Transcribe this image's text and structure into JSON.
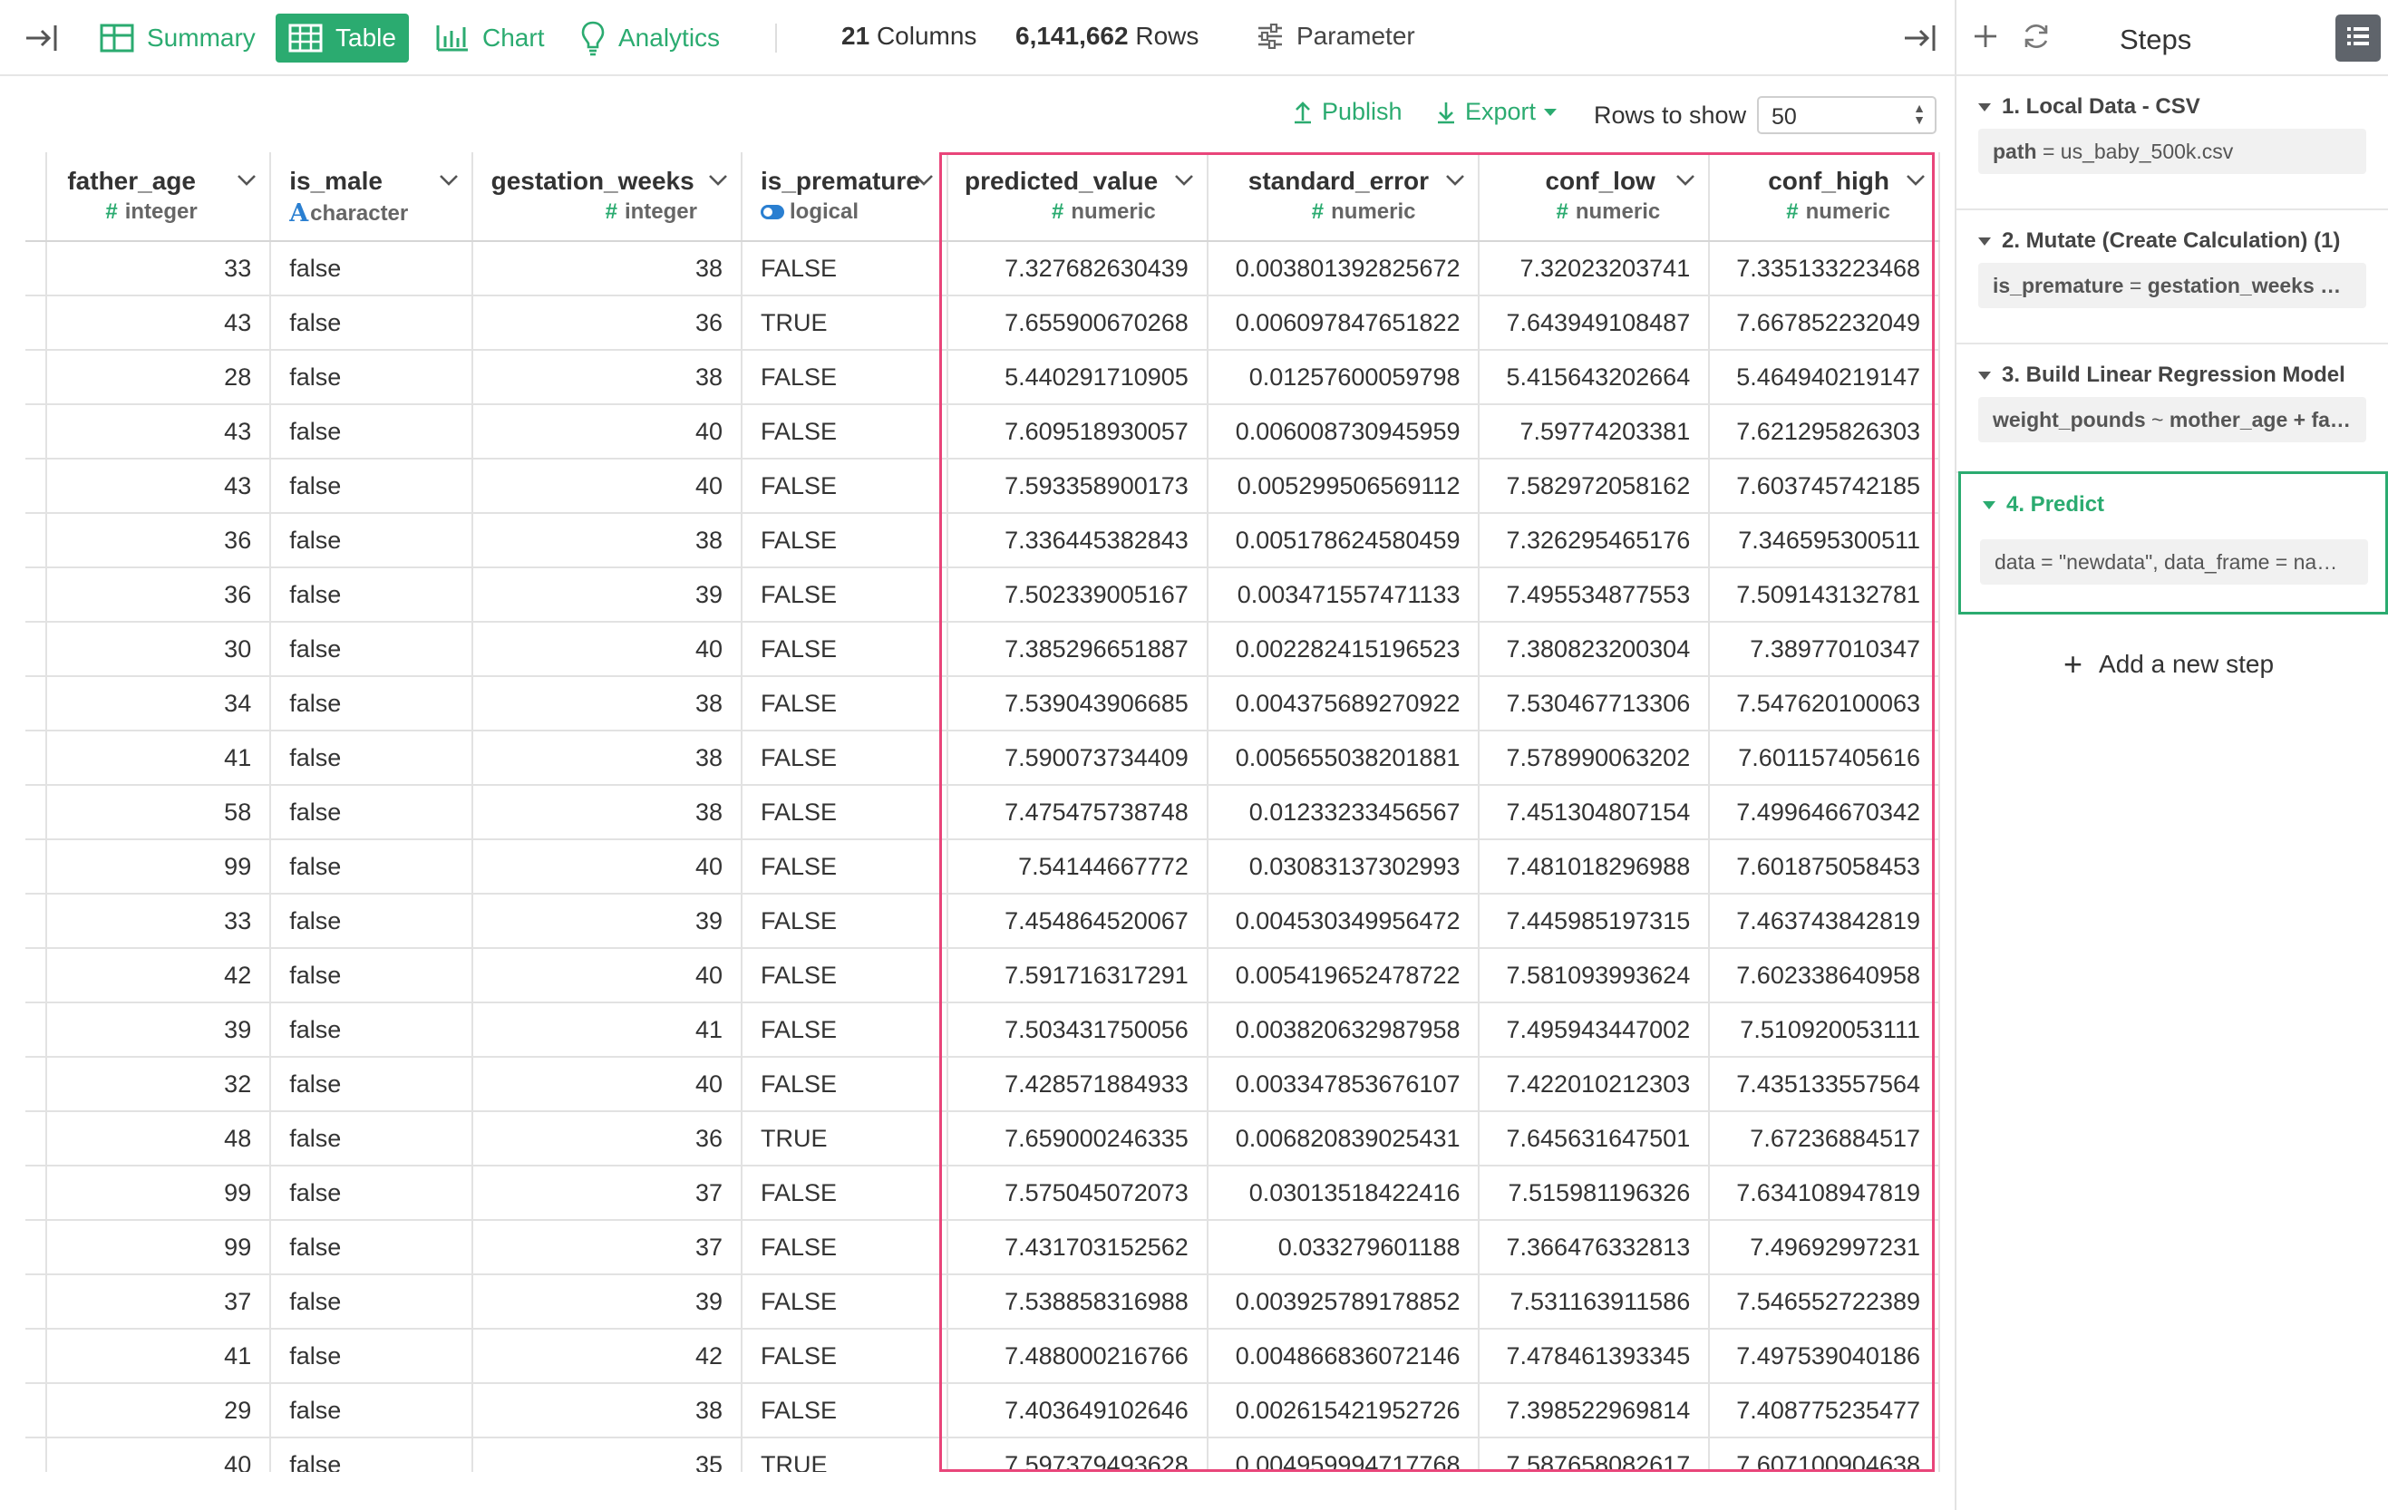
{
  "header": {
    "tabs": [
      {
        "label": "Summary",
        "icon": "summary-grid-icon"
      },
      {
        "label": "Table",
        "icon": "table-icon",
        "active": true
      },
      {
        "label": "Chart",
        "icon": "bar-chart-icon"
      },
      {
        "label": "Analytics",
        "icon": "lightbulb-icon"
      }
    ],
    "columns_count": "21",
    "columns_label": "Columns",
    "rows_count": "6,141,662",
    "rows_label": "Rows",
    "parameter_label": "Parameter"
  },
  "toolbar": {
    "publish_label": "Publish",
    "export_label": "Export",
    "rows_to_show_label": "Rows to show",
    "rows_to_show_value": "50"
  },
  "table": {
    "columns": [
      {
        "name": "father_age",
        "type": "integer",
        "type_icon": "hash"
      },
      {
        "name": "is_male",
        "type": "character",
        "type_icon": "A"
      },
      {
        "name": "gestation_weeks",
        "type": "integer",
        "type_icon": "hash"
      },
      {
        "name": "is_premature",
        "type": "logical",
        "type_icon": "toggle"
      },
      {
        "name": "predicted_value",
        "type": "numeric",
        "type_icon": "hash"
      },
      {
        "name": "standard_error",
        "type": "numeric",
        "type_icon": "hash"
      },
      {
        "name": "conf_low",
        "type": "numeric",
        "type_icon": "hash"
      },
      {
        "name": "conf_high",
        "type": "numeric",
        "type_icon": "hash"
      }
    ],
    "rows": [
      [
        "33",
        "false",
        "38",
        "FALSE",
        "7.327682630439",
        "0.003801392825672",
        "7.32023203741",
        "7.335133223468"
      ],
      [
        "43",
        "false",
        "36",
        "TRUE",
        "7.655900670268",
        "0.006097847651822",
        "7.643949108487",
        "7.667852232049"
      ],
      [
        "28",
        "false",
        "38",
        "FALSE",
        "5.440291710905",
        "0.01257600059798",
        "5.415643202664",
        "5.464940219147"
      ],
      [
        "43",
        "false",
        "40",
        "FALSE",
        "7.609518930057",
        "0.006008730945959",
        "7.59774203381",
        "7.621295826303"
      ],
      [
        "43",
        "false",
        "40",
        "FALSE",
        "7.593358900173",
        "0.005299506569112",
        "7.582972058162",
        "7.603745742185"
      ],
      [
        "36",
        "false",
        "38",
        "FALSE",
        "7.336445382843",
        "0.005178624580459",
        "7.326295465176",
        "7.346595300511"
      ],
      [
        "36",
        "false",
        "39",
        "FALSE",
        "7.502339005167",
        "0.003471557471133",
        "7.495534877553",
        "7.509143132781"
      ],
      [
        "30",
        "false",
        "40",
        "FALSE",
        "7.385296651887",
        "0.002282415196523",
        "7.380823200304",
        "7.38977010347"
      ],
      [
        "34",
        "false",
        "38",
        "FALSE",
        "7.539043906685",
        "0.004375689270922",
        "7.530467713306",
        "7.547620100063"
      ],
      [
        "41",
        "false",
        "38",
        "FALSE",
        "7.590073734409",
        "0.005655038201881",
        "7.578990063202",
        "7.601157405616"
      ],
      [
        "58",
        "false",
        "38",
        "FALSE",
        "7.475475738748",
        "0.01233233456567",
        "7.451304807154",
        "7.499646670342"
      ],
      [
        "99",
        "false",
        "40",
        "FALSE",
        "7.54144667772",
        "0.03083137302993",
        "7.481018296988",
        "7.601875058453"
      ],
      [
        "33",
        "false",
        "39",
        "FALSE",
        "7.454864520067",
        "0.004530349956472",
        "7.445985197315",
        "7.463743842819"
      ],
      [
        "42",
        "false",
        "40",
        "FALSE",
        "7.591716317291",
        "0.005419652478722",
        "7.581093993624",
        "7.602338640958"
      ],
      [
        "39",
        "false",
        "41",
        "FALSE",
        "7.503431750056",
        "0.003820632987958",
        "7.495943447002",
        "7.510920053111"
      ],
      [
        "32",
        "false",
        "40",
        "FALSE",
        "7.428571884933",
        "0.003347853676107",
        "7.422010212303",
        "7.435133557564"
      ],
      [
        "48",
        "false",
        "36",
        "TRUE",
        "7.659000246335",
        "0.006820839025431",
        "7.645631647501",
        "7.67236884517"
      ],
      [
        "99",
        "false",
        "37",
        "FALSE",
        "7.575045072073",
        "0.03013518422416",
        "7.515981196326",
        "7.634108947819"
      ],
      [
        "99",
        "false",
        "37",
        "FALSE",
        "7.431703152562",
        "0.033279601188",
        "7.366476332813",
        "7.49692997231"
      ],
      [
        "37",
        "false",
        "39",
        "FALSE",
        "7.538858316988",
        "0.003925789178852",
        "7.531163911586",
        "7.546552722389"
      ],
      [
        "41",
        "false",
        "42",
        "FALSE",
        "7.488000216766",
        "0.004866836072146",
        "7.478461393345",
        "7.497539040186"
      ],
      [
        "29",
        "false",
        "38",
        "FALSE",
        "7.403649102646",
        "0.002615421952726",
        "7.398522969814",
        "7.408775235477"
      ],
      [
        "40",
        "false",
        "35",
        "TRUE",
        "7.597379493628",
        "0.004959994717768",
        "7.587658082617",
        "7.607100904638"
      ]
    ]
  },
  "steps_panel": {
    "title": "Steps",
    "steps": [
      {
        "title": "1. Local Data - CSV",
        "body_key": "path",
        "body_op": " = ",
        "body_val": "us_baby_500k.csv",
        "active": false
      },
      {
        "title": "2. Mutate (Create Calculation) (1)",
        "body_key": "is_premature",
        "body_op": " = ",
        "body_val": "gestation_weeks …",
        "active": false
      },
      {
        "title": "3. Build Linear Regression Model",
        "body_key": "weight_pounds",
        "body_op": " ~ ",
        "body_val": "mother_age + fa…",
        "active": false
      },
      {
        "title": "4. Predict",
        "body_key": "data",
        "body_op": " = ",
        "body_val": "\"newdata\", data_frame = na…",
        "active": true
      }
    ],
    "add_step_label": "Add a new step"
  },
  "colors": {
    "accent": "#2bab70",
    "highlight": "#e9457a",
    "type_blue": "#2a7fd1"
  }
}
